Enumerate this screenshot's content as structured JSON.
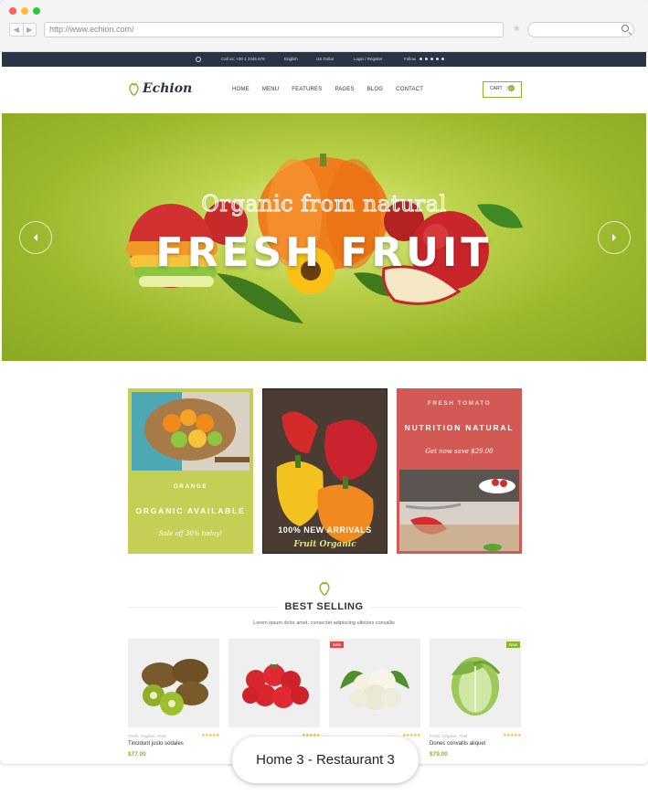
{
  "browser": {
    "url": "http://www.echion.com/",
    "colors": {
      "close": "#ff5f57",
      "minimize": "#ffbd2e",
      "maximize": "#28c840"
    }
  },
  "topbar": {
    "phone": "Call us: +00 1 2345 678",
    "language": "English",
    "currency": "US Dollar",
    "account": "Login / Register",
    "follow": "Follow",
    "social_icons": [
      "facebook-icon",
      "twitter-icon",
      "vimeo-icon",
      "pinterest-icon",
      "instagram-icon"
    ]
  },
  "header": {
    "logo": "Echion",
    "menu": [
      "HOME",
      "MENU",
      "FEATURES",
      "PAGES",
      "BLOG",
      "CONTACT"
    ],
    "cart_label": "CART",
    "cart_count": "0"
  },
  "hero": {
    "subtitle": "Organic from natural",
    "title": "FRESH FRUIT"
  },
  "banners": [
    {
      "small": "ORANGE",
      "big": "ORGANIC AVAILABLE",
      "italic": "Sale off 30% today!",
      "color": "#c6cf55"
    },
    {
      "big": "100% NEW ARRIVALS",
      "italic": "Fruit Organic",
      "color": "#3a302a"
    },
    {
      "small": "FRESH TOMATO",
      "big": "NUTRITION NATURAL",
      "italic": "Get now save $29.00",
      "color": "#d35a54"
    }
  ],
  "best_selling": {
    "title": "BEST SELLING",
    "subtitle": "Lorem ipsum dolor amet, consectet adipiscing  ultricies convallis"
  },
  "products": [
    {
      "category": "Fresh, Organic, Fruit",
      "name": "Tincidunt justo sodales",
      "price": "$77.00",
      "tag": ""
    },
    {
      "category": "",
      "name": "",
      "price": "",
      "tag": ""
    },
    {
      "category": "",
      "name": "",
      "price": "",
      "tag": "Sale"
    },
    {
      "category": "Fresh, Organic, Fruit",
      "name": "Donec convallis aliquet",
      "price": "$79.00",
      "tag": "New"
    }
  ],
  "caption": "Home 3 - Restaurant 3",
  "accent": "#8ab62f"
}
